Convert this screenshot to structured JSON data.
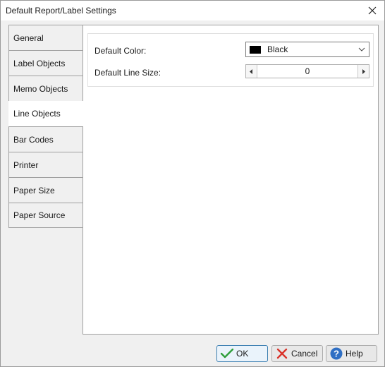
{
  "window": {
    "title": "Default Report/Label Settings"
  },
  "tabs": [
    {
      "label": "General"
    },
    {
      "label": "Label Objects"
    },
    {
      "label": "Memo Objects"
    },
    {
      "label": "Line Objects"
    },
    {
      "label": "Bar Codes"
    },
    {
      "label": "Printer"
    },
    {
      "label": "Paper Size"
    },
    {
      "label": "Paper Source"
    }
  ],
  "active_tab": "Line Objects",
  "line_objects": {
    "default_color_label": "Default Color:",
    "default_color_value": "Black",
    "default_color_swatch": "#000000",
    "default_line_size_label": "Default Line Size:",
    "default_line_size_value": "0"
  },
  "buttons": {
    "ok": "OK",
    "cancel": "Cancel",
    "help": "Help"
  },
  "icons": {
    "close": "close-icon",
    "ok": "checkmark-icon",
    "cancel": "x-icon",
    "help": "question-icon",
    "dropdown": "chevron-down-icon",
    "spin_left": "triangle-left-icon",
    "spin_right": "triangle-right-icon"
  },
  "colors": {
    "ok_check": "#2e9e3a",
    "cancel_x": "#d9342b",
    "help_circle": "#2f6fc4"
  }
}
